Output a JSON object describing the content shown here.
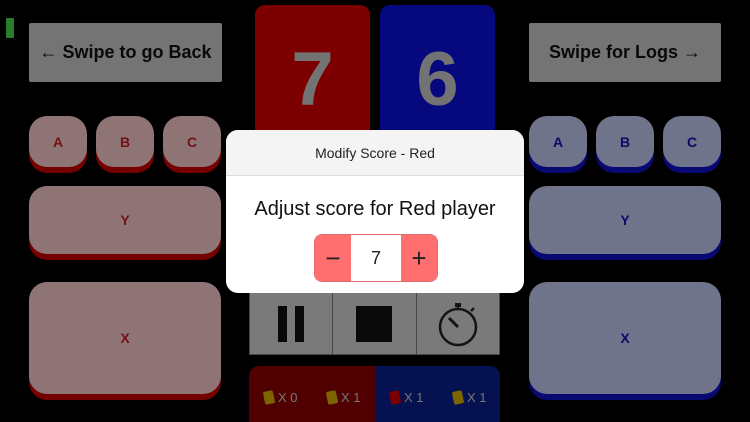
{
  "nav": {
    "back_label": "← Swipe to go Back",
    "logs_label": "Swipe for Logs →"
  },
  "scores": {
    "red": "7",
    "blue": "6"
  },
  "red_pads": {
    "a": "A",
    "b": "B",
    "c": "C",
    "y": "Y",
    "x": "X"
  },
  "blue_pads": {
    "a": "A",
    "b": "B",
    "c": "C",
    "y": "Y",
    "x": "X"
  },
  "cards": {
    "red_yellow": "X 0",
    "red_green": "X 1",
    "blue_yellow": "X 1",
    "blue_green": "X 1"
  },
  "modal": {
    "title": "Modify Score - Red",
    "message": "Adjust score for Red player",
    "minus": "−",
    "value": "7",
    "plus": "+"
  },
  "colors": {
    "red": "#d80000",
    "blue": "#0a10d8",
    "stepper": "#ff6f6f"
  },
  "icons": [
    "pause-icon",
    "stop-icon",
    "stopwatch-icon"
  ]
}
